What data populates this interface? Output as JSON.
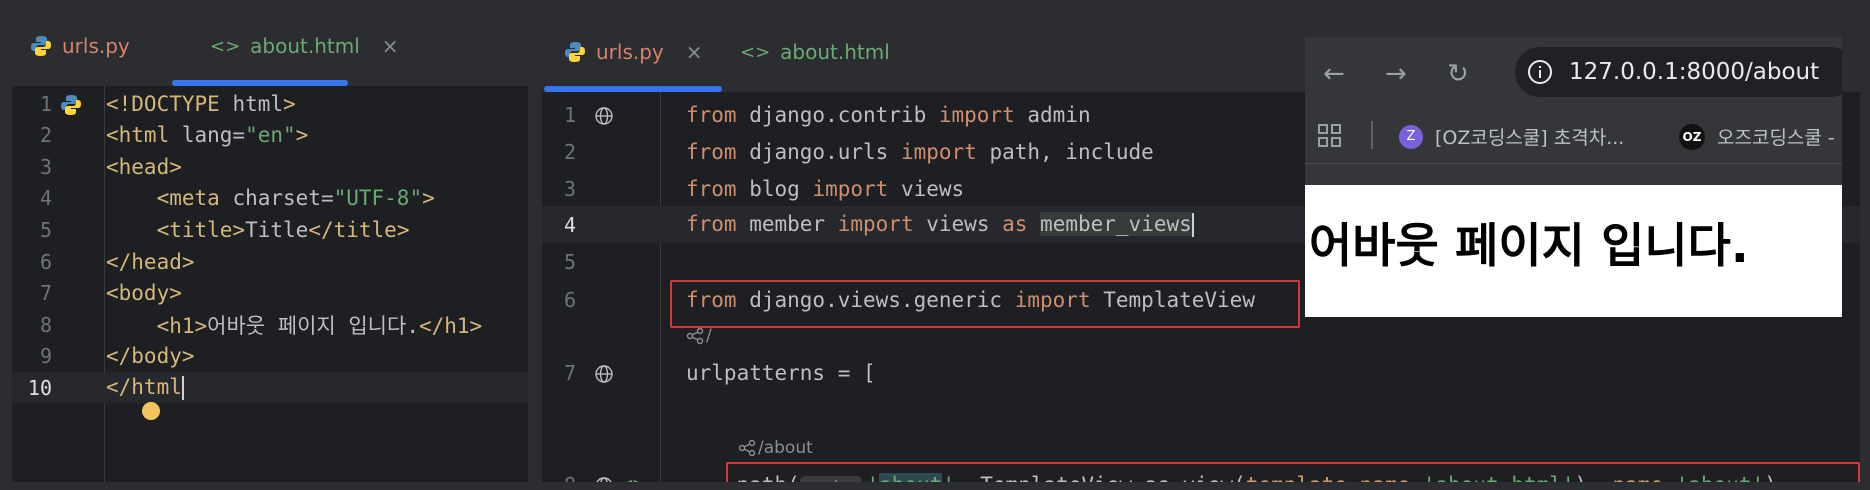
{
  "left_editor": {
    "tabs": [
      {
        "label": "urls.py",
        "icon": "python-icon",
        "color": "#d7836a"
      },
      {
        "label": "about.html",
        "icon": "html-icon",
        "color": "#6aab73",
        "close": "×",
        "active": true
      }
    ],
    "lines": [
      {
        "n": "1",
        "parts": [
          [
            "tag",
            "<!DOCTYPE "
          ],
          [
            "attr",
            "html"
          ],
          [
            "tag",
            ">"
          ]
        ]
      },
      {
        "n": "2",
        "parts": [
          [
            "tag",
            "<html "
          ],
          [
            "attr",
            "lang="
          ],
          [
            "str",
            "\"en\""
          ],
          [
            "tag",
            ">"
          ]
        ]
      },
      {
        "n": "3",
        "parts": [
          [
            "tag",
            "<head>"
          ]
        ]
      },
      {
        "n": "4",
        "parts": [
          [
            "attr",
            "    "
          ],
          [
            "tag",
            "<meta "
          ],
          [
            "attr",
            "charset="
          ],
          [
            "str",
            "\"UTF-8\""
          ],
          [
            "tag",
            ">"
          ]
        ]
      },
      {
        "n": "5",
        "parts": [
          [
            "attr",
            "    "
          ],
          [
            "tag",
            "<title>"
          ],
          [
            "attr",
            "Title"
          ],
          [
            "tag",
            "</title>"
          ]
        ]
      },
      {
        "n": "6",
        "parts": [
          [
            "tag",
            "</head>"
          ]
        ]
      },
      {
        "n": "7",
        "parts": [
          [
            "tag",
            "<body>"
          ]
        ]
      },
      {
        "n": "8",
        "parts": [
          [
            "attr",
            "    "
          ],
          [
            "tag",
            "<h1>"
          ],
          [
            "attr",
            "어바웃 페이지 입니다."
          ],
          [
            "tag",
            "</h1>"
          ]
        ]
      },
      {
        "n": "9",
        "parts": [
          [
            "tag",
            "</body>"
          ]
        ]
      },
      {
        "n": "10",
        "parts": [
          [
            "tag",
            "</html"
          ]
        ]
      }
    ]
  },
  "right_editor": {
    "tabs": [
      {
        "label": "urls.py",
        "icon": "python-icon",
        "color": "#d7836a",
        "close": "×",
        "active": true
      },
      {
        "label": "about.html",
        "icon": "html-icon",
        "color": "#6aab73"
      }
    ],
    "lines": [
      {
        "n": "1",
        "parts": [
          [
            "kw",
            "from "
          ],
          [
            "attr",
            "django.contrib "
          ],
          [
            "kw",
            "import "
          ],
          [
            "attr",
            "admin"
          ]
        ]
      },
      {
        "n": "2",
        "parts": [
          [
            "kw",
            "from "
          ],
          [
            "attr",
            "django.urls "
          ],
          [
            "kw",
            "import "
          ],
          [
            "attr",
            "path, include"
          ]
        ]
      },
      {
        "n": "3",
        "parts": [
          [
            "kw",
            "from "
          ],
          [
            "attr",
            "blog "
          ],
          [
            "kw",
            "import "
          ],
          [
            "attr",
            "views"
          ]
        ]
      },
      {
        "n": "4",
        "parts": [
          [
            "kw",
            "from "
          ],
          [
            "attr",
            "member "
          ],
          [
            "kw",
            "import "
          ],
          [
            "attr",
            "views "
          ],
          [
            "kw",
            "as "
          ],
          [
            "attr",
            "member_views"
          ]
        ]
      },
      {
        "n": "5",
        "parts": []
      },
      {
        "n": "6",
        "parts": [
          [
            "kw",
            "from "
          ],
          [
            "attr",
            "django.views.generic "
          ],
          [
            "kw",
            "import "
          ],
          [
            "attr",
            "TemplateView"
          ]
        ]
      },
      {
        "n": "7",
        "parts": [
          [
            "attr",
            "urlpatterns = ["
          ]
        ]
      },
      {
        "n": "8",
        "parts": [
          [
            "attr",
            "    path("
          ]
        ]
      }
    ],
    "hint_route_label": "route:",
    "hint_about_path": "/about",
    "line8_rest": {
      "q1": "'",
      "about": "about",
      "q2": "'",
      "mid": ", TemplateView.as_view(",
      "p1": "template_name",
      "eq1": "=",
      "s1": "'about.html'",
      "c": "), ",
      "p2": "name",
      "eq2": "=",
      "s2": "'about'",
      "end": "),"
    }
  },
  "browser": {
    "url": "127.0.0.1:8000/about",
    "bookmarks": [
      {
        "label": "[OZ코딩스쿨] 초격차...",
        "badge": "Z"
      },
      {
        "label": "오즈코딩스쿨 -",
        "badge": "OZ"
      }
    ],
    "heading": "어바웃 페이지 입니다."
  }
}
